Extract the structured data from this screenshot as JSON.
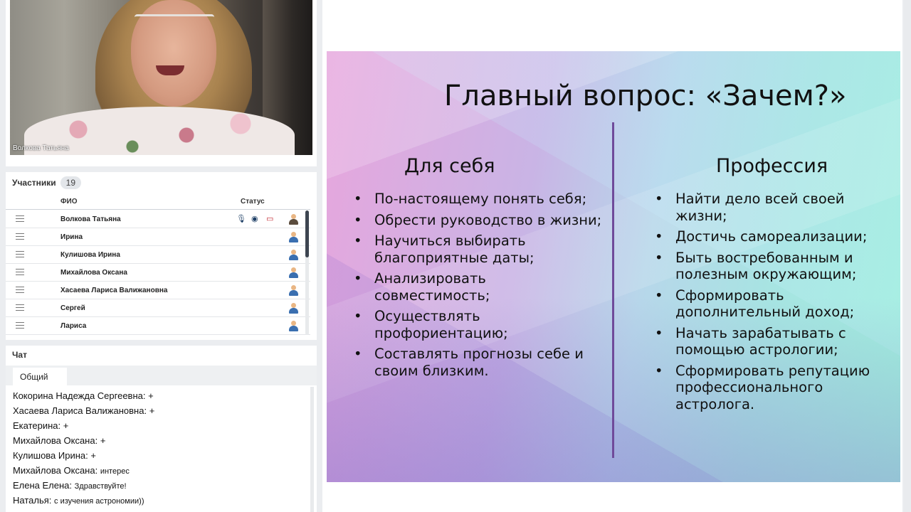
{
  "video": {
    "speaker_name": "Волкова Татьяна"
  },
  "participants": {
    "title": "Участники",
    "count": "19",
    "col_name": "ФИО",
    "col_status": "Статус",
    "rows": [
      {
        "name": "Волкова Татьяна",
        "host": true
      },
      {
        "name": "Ирина"
      },
      {
        "name": "Кулишова Ирина"
      },
      {
        "name": "Михайлова Оксана"
      },
      {
        "name": "Хасаева Лариса Валижановна"
      },
      {
        "name": "Сергей"
      },
      {
        "name": "Лариса"
      }
    ]
  },
  "chat": {
    "title": "Чат",
    "tab": "Общий",
    "messages": [
      {
        "author": "Кокорина Надежда  Сергеевна:",
        "text": "+"
      },
      {
        "author": "Хасаева Лариса Валижановна:",
        "text": "+"
      },
      {
        "author": "Екатерина:",
        "text": "+"
      },
      {
        "author": "Михайлова Оксана:",
        "text": "+"
      },
      {
        "author": "Кулишова Ирина:",
        "text": "+"
      },
      {
        "author": "Михайлова Оксана:",
        "text": "интерес"
      },
      {
        "author": "Елена  Елена:",
        "text": "Здравствуйте!"
      },
      {
        "author": "Наталья:",
        "text": "с изучения астрономии))"
      }
    ]
  },
  "slide": {
    "title": "Главный вопрос: «Зачем?»",
    "left": {
      "heading": "Для себя",
      "items": [
        "По-настоящему понять себя;",
        "Обрести руководство в жизни;",
        "Научиться выбирать благоприятные даты;",
        "Анализировать совместимость;",
        "Осуществлять профориентацию;",
        "Составлять прогнозы себе и своим близким."
      ]
    },
    "right": {
      "heading": "Профессия",
      "items": [
        "Найти дело всей своей жизни;",
        "Достичь самореализации;",
        "Быть востребованным и полезным окружающим;",
        "Сформировать дополнительный доход;",
        "Начать зарабатывать с помощью астрологии;",
        "Сформировать репутацию профессионального астролога."
      ]
    }
  }
}
